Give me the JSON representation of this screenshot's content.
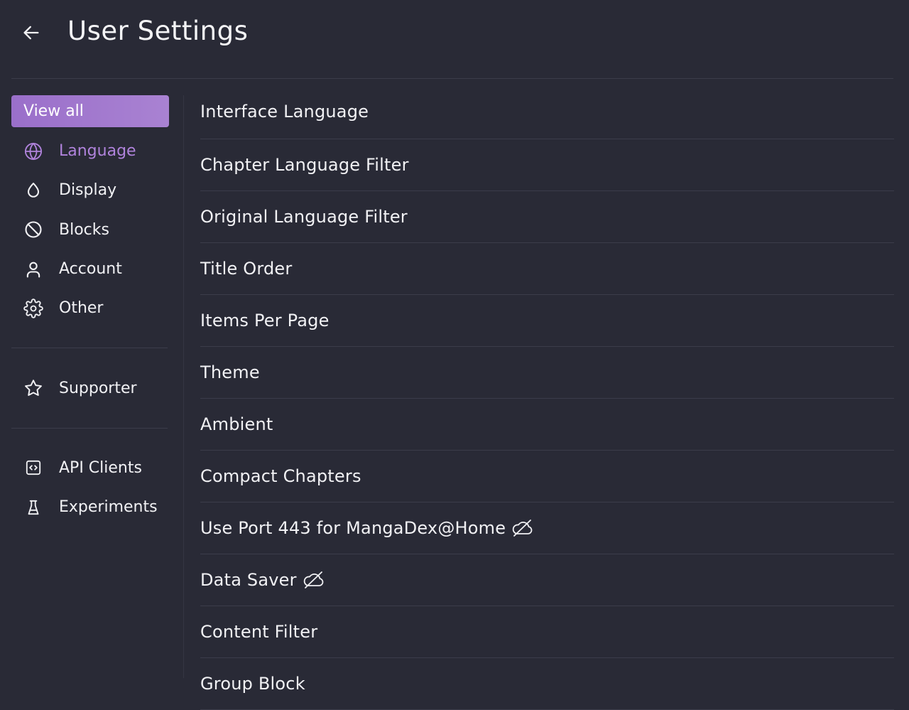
{
  "header": {
    "title": "User Settings",
    "back_icon": "arrow-left-icon"
  },
  "sidebar": {
    "view_all_label": "View all",
    "active_color": "#b083dc",
    "accent_color": "#a57ad0",
    "groups": [
      {
        "items": [
          {
            "label": "Language",
            "icon": "globe-icon",
            "active": true
          },
          {
            "label": "Display",
            "icon": "droplet-icon",
            "active": false
          },
          {
            "label": "Blocks",
            "icon": "ban-icon",
            "active": false
          },
          {
            "label": "Account",
            "icon": "user-icon",
            "active": false
          },
          {
            "label": "Other",
            "icon": "gear-icon",
            "active": false
          }
        ]
      },
      {
        "items": [
          {
            "label": "Supporter",
            "icon": "star-icon",
            "active": false
          }
        ]
      },
      {
        "items": [
          {
            "label": "API Clients",
            "icon": "code-square-icon",
            "active": false
          },
          {
            "label": "Experiments",
            "icon": "flask-icon",
            "active": false
          }
        ]
      }
    ]
  },
  "settings": [
    {
      "label": "Interface Language",
      "offline_icon": false
    },
    {
      "label": "Chapter Language Filter",
      "offline_icon": false
    },
    {
      "label": "Original Language Filter",
      "offline_icon": false
    },
    {
      "label": "Title Order",
      "offline_icon": false
    },
    {
      "label": "Items Per Page",
      "offline_icon": false
    },
    {
      "label": "Theme",
      "offline_icon": false
    },
    {
      "label": "Ambient",
      "offline_icon": false
    },
    {
      "label": "Compact Chapters",
      "offline_icon": false
    },
    {
      "label": "Use Port 443 for MangaDex@Home",
      "offline_icon": true
    },
    {
      "label": "Data Saver",
      "offline_icon": true
    },
    {
      "label": "Content Filter",
      "offline_icon": false
    },
    {
      "label": "Group Block",
      "offline_icon": false
    }
  ]
}
